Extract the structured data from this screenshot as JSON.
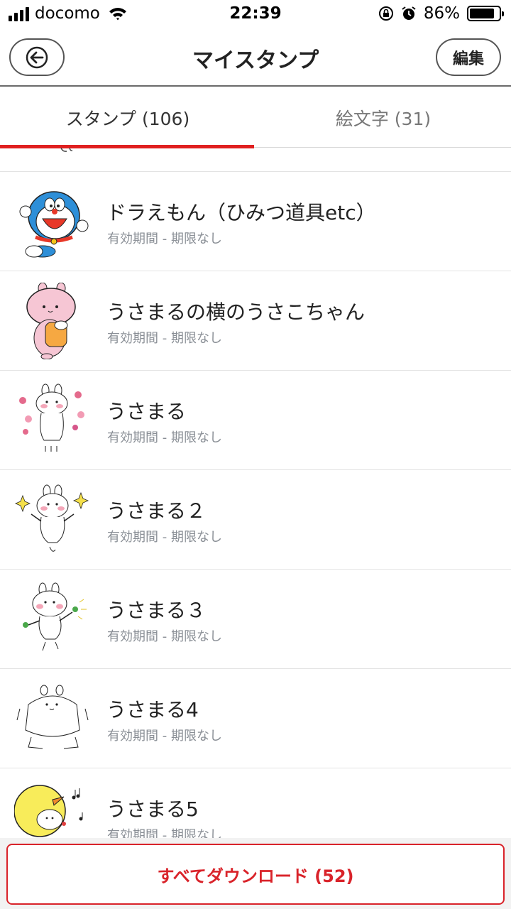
{
  "status_bar": {
    "carrier": "docomo",
    "time": "22:39",
    "battery_percent": "86%",
    "battery_level": 0.86,
    "icons": [
      "signal-icon",
      "wifi-icon",
      "orientation-lock-icon",
      "alarm-icon",
      "battery-icon"
    ]
  },
  "nav": {
    "title": "マイスタンプ",
    "back_icon": "back-arrow-icon",
    "edit_label": "編集"
  },
  "tabs": [
    {
      "label": "スタンプ (106)",
      "active": true
    },
    {
      "label": "絵文字 (31)",
      "active": false
    }
  ],
  "colors": {
    "accent": "#e02020",
    "subtext": "#8a8f96"
  },
  "stamps": [
    {
      "title": "ドラえもん（ひみつ道具etc）",
      "subtitle": "有効期間 - 期限なし",
      "icon": "doraemon-sticker-icon"
    },
    {
      "title": "うさまるの横のうさこちゃん",
      "subtitle": "有効期間 - 期限なし",
      "icon": "pink-rabbit-sticker-icon"
    },
    {
      "title": "うさまる",
      "subtitle": "有効期間 - 期限なし",
      "icon": "usamaru-flowers-sticker-icon"
    },
    {
      "title": "うさまる２",
      "subtitle": "有効期間 - 期限なし",
      "icon": "usamaru-sparkle-sticker-icon"
    },
    {
      "title": "うさまる３",
      "subtitle": "有効期間 - 期限なし",
      "icon": "usamaru-clover-sticker-icon"
    },
    {
      "title": "うさまる4",
      "subtitle": "有効期間 - 期限なし",
      "icon": "usamaru-stretch-sticker-icon"
    },
    {
      "title": "うさまる5",
      "subtitle": "有効期間 - 期限なし",
      "icon": "usamaru-chick-sticker-icon"
    }
  ],
  "download_all_label": "すべてダウンロード (52)"
}
